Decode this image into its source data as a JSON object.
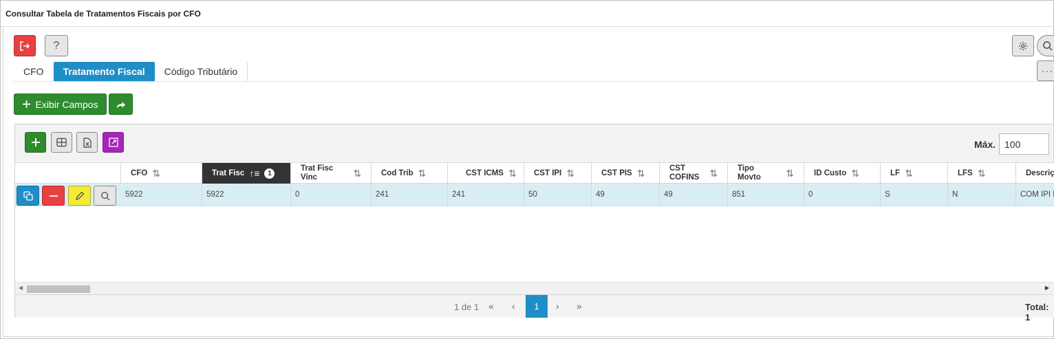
{
  "window": {
    "title": "Consultar Tabela de Tratamentos Fiscais por CFO"
  },
  "toolbar": {
    "help_label": "?",
    "more_label": "···"
  },
  "tabs": [
    {
      "label": "CFO",
      "active": false
    },
    {
      "label": "Tratamento Fiscal",
      "active": true
    },
    {
      "label": "Código Tributário",
      "active": false
    }
  ],
  "actions": {
    "exibir_campos_label": "Exibir Campos"
  },
  "grid": {
    "max_label": "Máx.",
    "max_value": "100",
    "sort_badge": "1",
    "columns": [
      {
        "label": "CFO"
      },
      {
        "label": "Trat Fisc"
      },
      {
        "label": "Trat Fisc Vinc"
      },
      {
        "label": "Cod Trib"
      },
      {
        "label": "CST ICMS"
      },
      {
        "label": "CST IPI"
      },
      {
        "label": "CST PIS"
      },
      {
        "label": "CST COFINS"
      },
      {
        "label": "Tipo Movto"
      },
      {
        "label": "ID Custo"
      },
      {
        "label": "LF"
      },
      {
        "label": "LFS"
      },
      {
        "label": "Descriç"
      }
    ],
    "rows": [
      {
        "cells": [
          "5922",
          "5922",
          "0",
          "241",
          "241",
          "50",
          "49",
          "49",
          "851",
          "0",
          "S",
          "N",
          "COM IPI E"
        ]
      }
    ]
  },
  "pagination": {
    "info": "1 de 1",
    "current": "1",
    "total_label": "Total: 1"
  },
  "colors": {
    "primary": "#1e8ec8",
    "success": "#2e8b2e",
    "danger": "#e84141",
    "warning": "#f5e93a",
    "purple": "#a526b8",
    "row_selected": "#d9eef4"
  }
}
